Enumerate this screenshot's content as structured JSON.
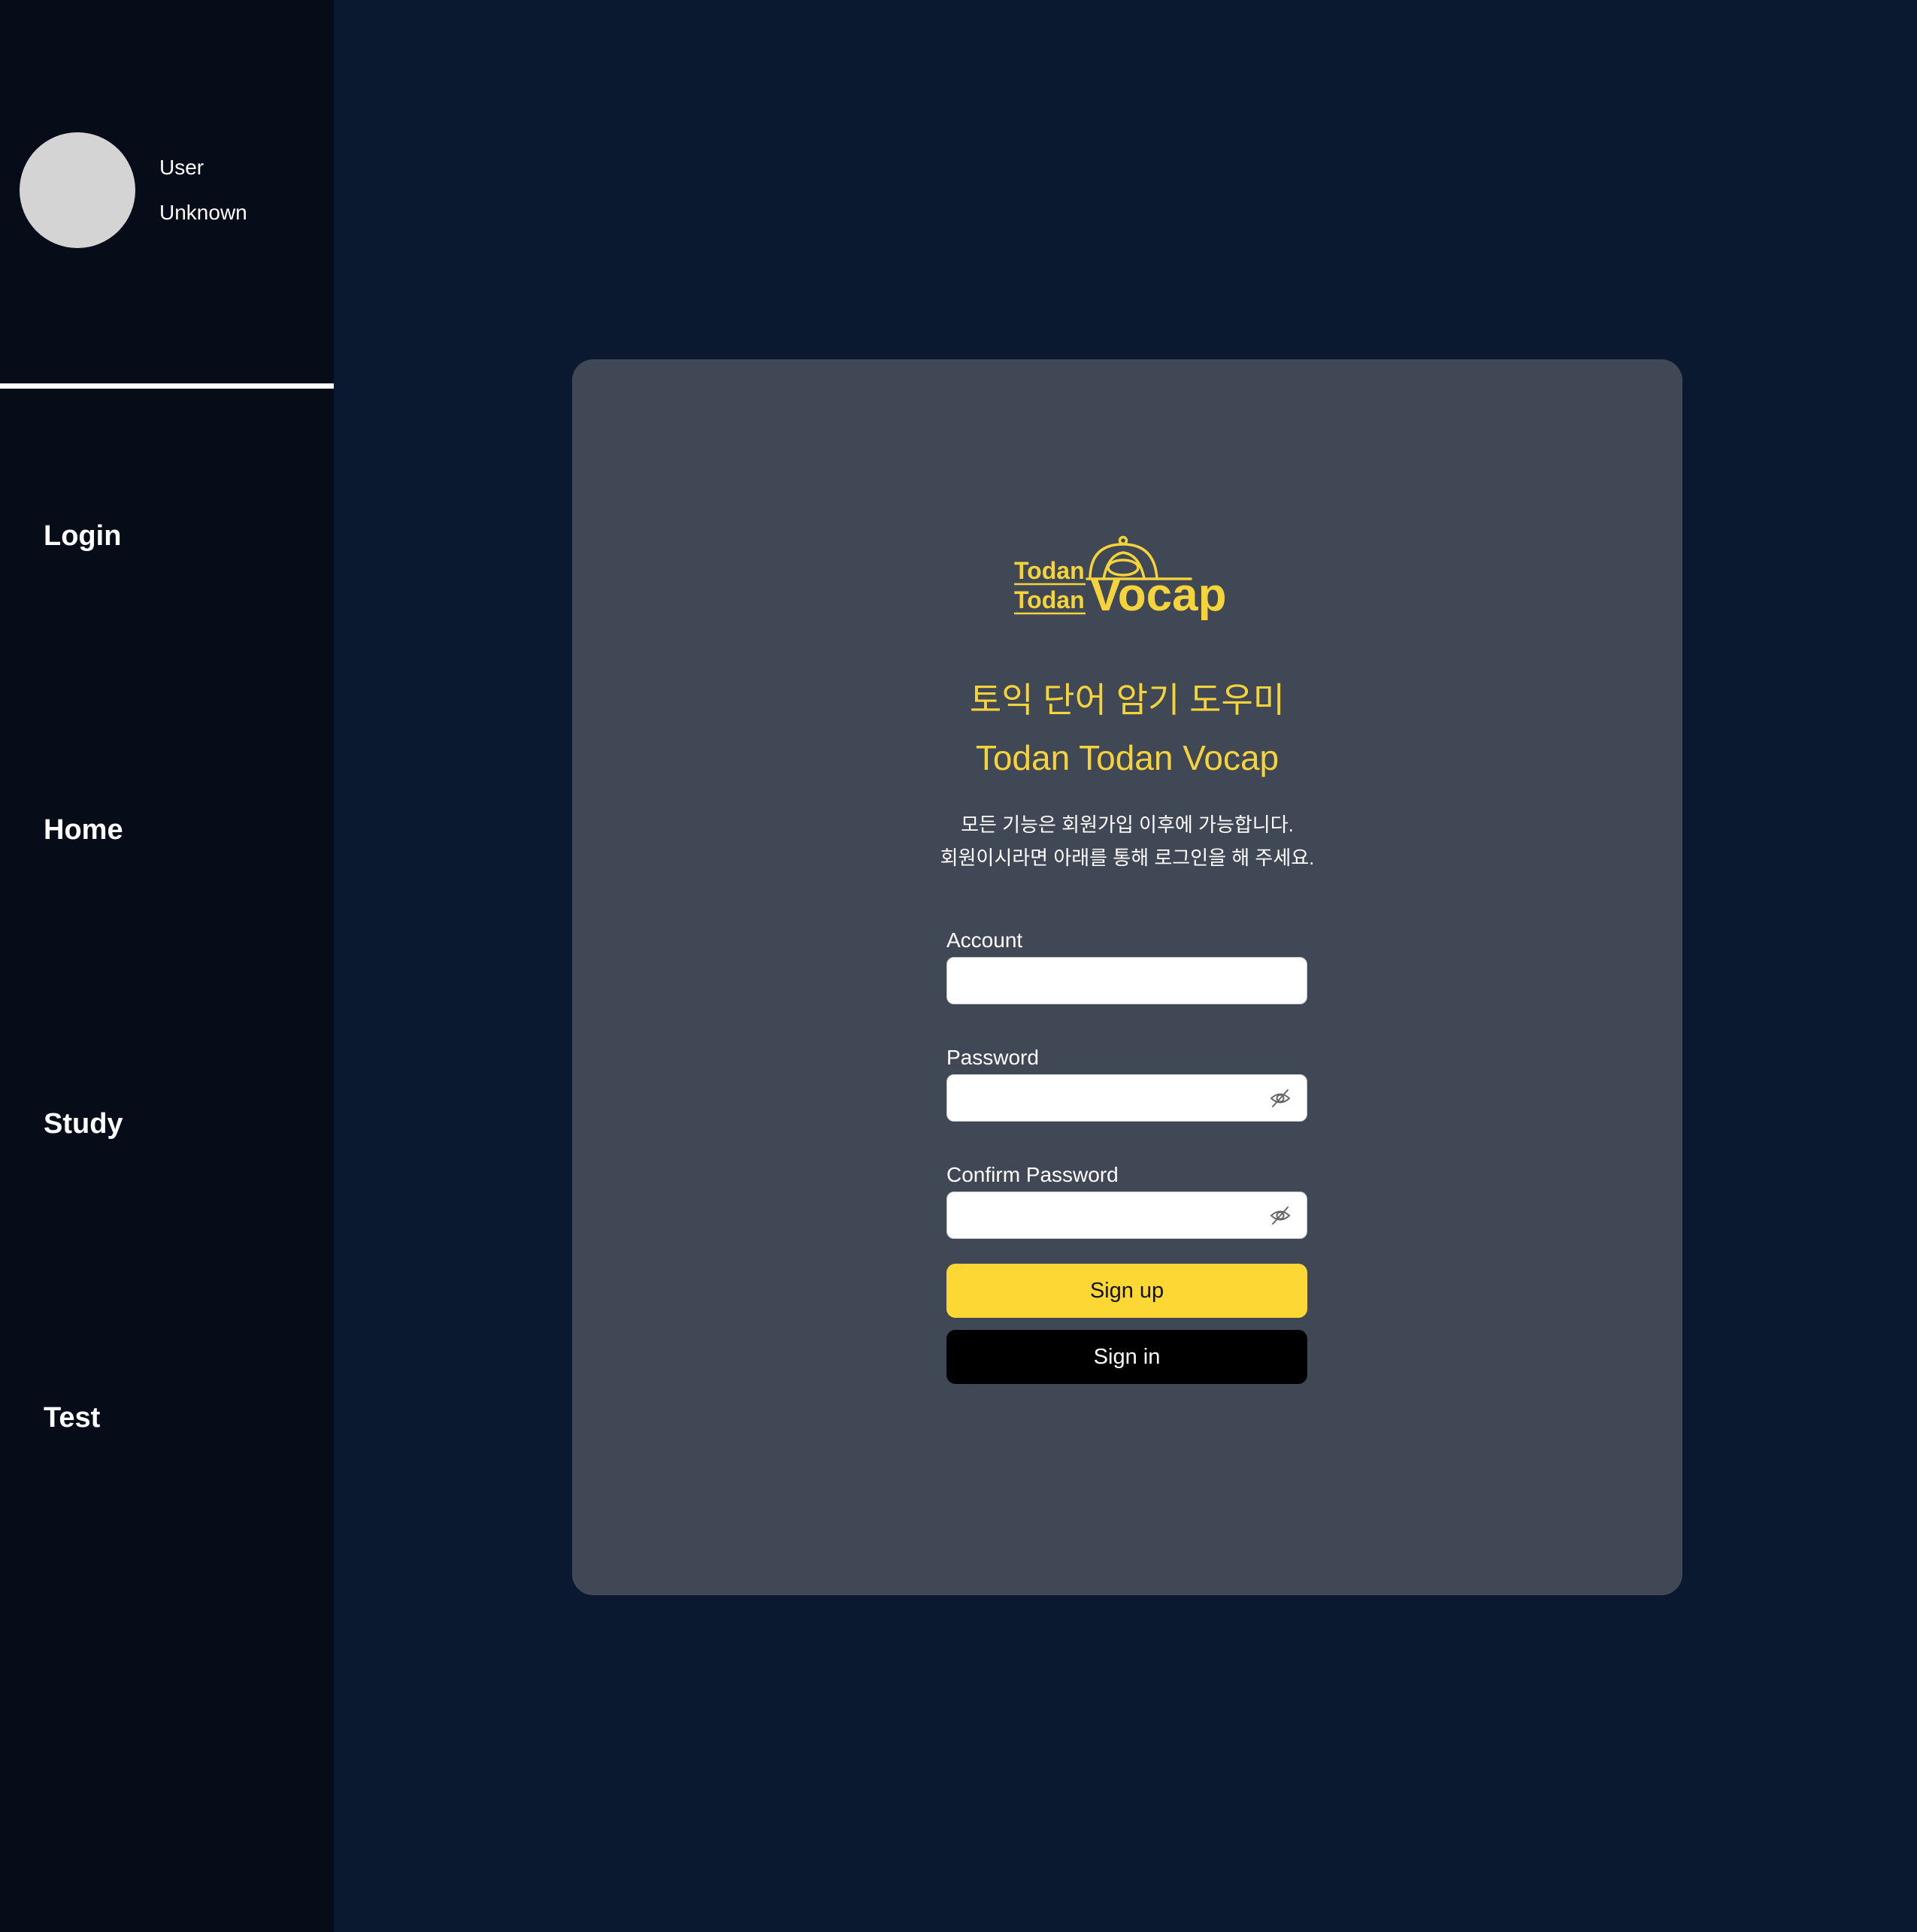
{
  "profile": {
    "name": "User",
    "status": "Unknown"
  },
  "nav": {
    "items": [
      {
        "label": "Login"
      },
      {
        "label": "Home"
      },
      {
        "label": "Study"
      },
      {
        "label": "Test"
      }
    ]
  },
  "logo": {
    "line1": "Todan",
    "line2": "Todan",
    "word": "Vocap",
    "icon": "rice-bowl-icon"
  },
  "card": {
    "title_ko": "토익 단어 암기 도우미",
    "title_en": "Todan Todan Vocap",
    "notice_line1": "모든 기능은 회원가입 이후에 가능합니다.",
    "notice_line2": "회원이시라면 아래를 통해 로그인을 해 주세요."
  },
  "form": {
    "account": {
      "label": "Account",
      "value": "",
      "placeholder": ""
    },
    "password": {
      "label": "Password",
      "value": "",
      "placeholder": "",
      "toggle_icon": "eye-off-icon"
    },
    "confirm_password": {
      "label": "Confirm Password",
      "value": "",
      "placeholder": "",
      "toggle_icon": "eye-off-icon"
    },
    "signup_label": "Sign up",
    "signin_label": "Sign in"
  },
  "colors": {
    "page_bg": "#0b1930",
    "sidebar_bg": "#060d18",
    "card_bg": "#414855",
    "accent_yellow": "#f5d33a",
    "signup_bg": "#fdd835",
    "signin_bg": "#000000"
  }
}
